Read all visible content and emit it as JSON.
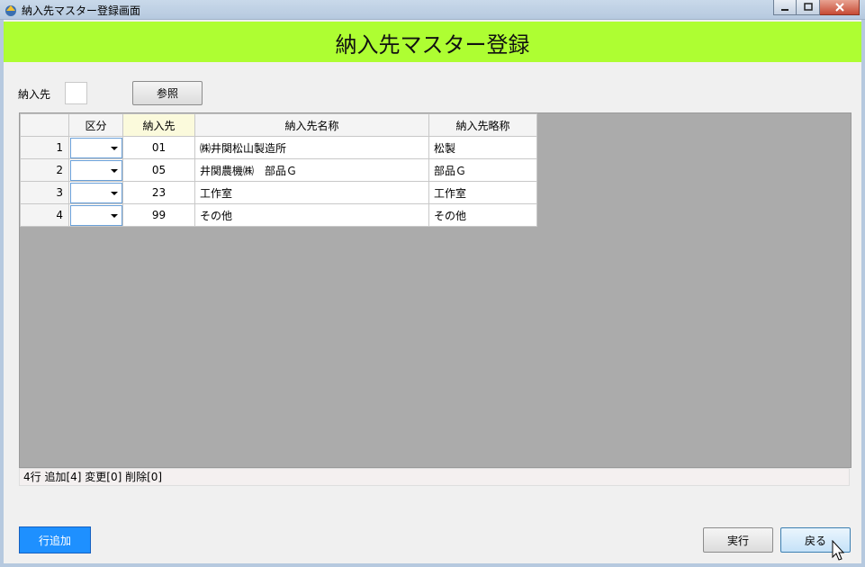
{
  "window": {
    "title": "納入先マスター登録画面"
  },
  "header": {
    "title": "納入先マスター登録"
  },
  "form": {
    "label": "納入先",
    "value": "",
    "ref_button": "参照"
  },
  "grid": {
    "columns": [
      "",
      "区分",
      "納入先",
      "納入先名称",
      "納入先略称"
    ],
    "rows": [
      {
        "num": "1",
        "kubun": "",
        "code": "01",
        "name": "㈱井関松山製造所",
        "abbr": "松製"
      },
      {
        "num": "2",
        "kubun": "",
        "code": "05",
        "name": "井関農機㈱　部品Ｇ",
        "abbr": "部品Ｇ"
      },
      {
        "num": "3",
        "kubun": "",
        "code": "23",
        "name": "工作室",
        "abbr": "工作室"
      },
      {
        "num": "4",
        "kubun": "",
        "code": "99",
        "name": "その他",
        "abbr": "その他"
      }
    ]
  },
  "status": {
    "text": "4行  追加[4]  変更[0]  削除[0]"
  },
  "footer": {
    "add_row": "行追加",
    "run": "実行",
    "back": "戻る"
  },
  "colors": {
    "header_band": "#aefe32",
    "add_button": "#1e90ff",
    "grid_background": "#ababab"
  }
}
